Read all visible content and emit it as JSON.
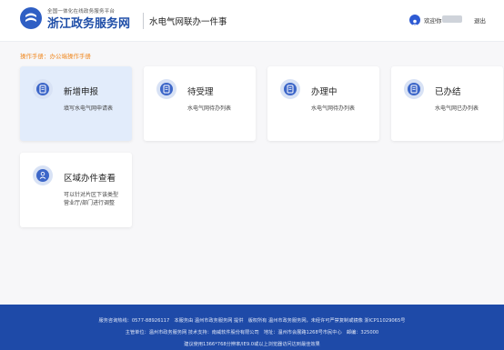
{
  "header": {
    "brand_small": "全国一体化在线政务服务平台",
    "brand_big": "浙江政务服务网",
    "service_title": "水电气网联办一件事",
    "greeting": "欢迎你",
    "logout": "退出"
  },
  "manual_link": "操作手册：办公端操作手册",
  "cards": [
    {
      "title": "新增申报",
      "desc": "填写水电气网申请表",
      "active": true
    },
    {
      "title": "待受理",
      "desc": "水电气网待办列表"
    },
    {
      "title": "办理中",
      "desc": "水电气网待办列表"
    },
    {
      "title": "已办结",
      "desc": "水电气网已办列表"
    },
    {
      "title": "区域办件查看",
      "desc": "可以针对片区下该类型营业厅/部门进行调整"
    }
  ],
  "footer": {
    "line1": "服务咨询热线：0577-88926117　本服务由 温州市政务服务网 提供　版权所有 温州市政务服务网，未经许可严禁复制或镜像 浙ICP11029065号",
    "line2": "主管单位：温州市政务服务网 技术支持：南威软件股份有限公司　地址：温州市会展路1268号市民中心　邮编：325000",
    "line3": "建议使用1366*768分辨率/IE9.0或以上浏览器访问达到最佳效果"
  },
  "colors": {
    "brand": "#1f4ea8",
    "accent": "#f08a24",
    "footer": "#1e4aa8",
    "active_card": "#e2ecfb"
  }
}
